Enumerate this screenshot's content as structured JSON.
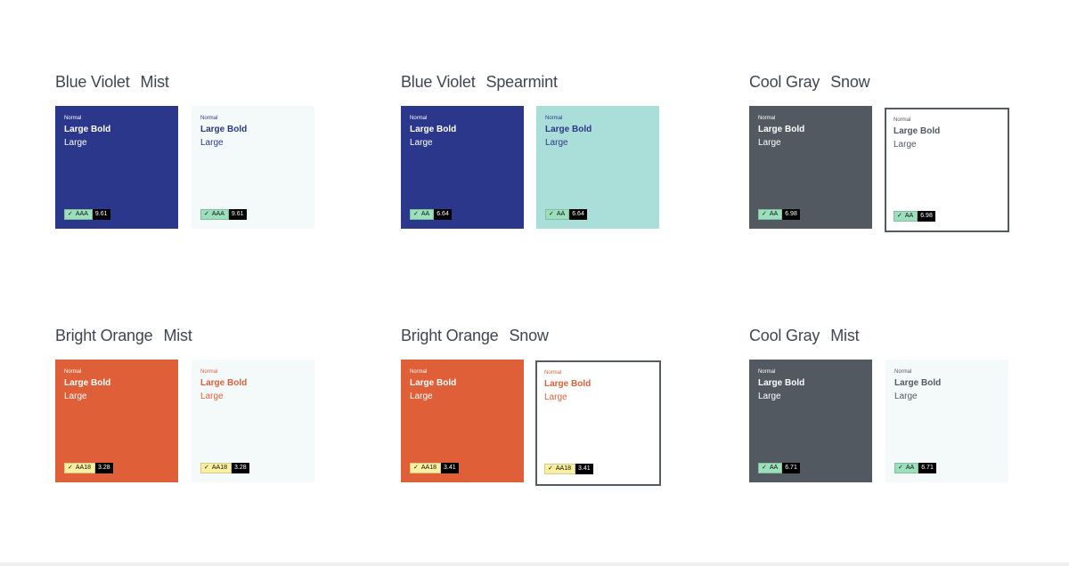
{
  "labels": {
    "normal": "Normal",
    "large_bold": "Large Bold",
    "large": "Large"
  },
  "colors": {
    "blue_violet": "#2b378a",
    "mist": "#f4fafa",
    "spearmint": "#aadfd9",
    "cool_gray": "#535961",
    "snow": "#ffffff",
    "bright_orange": "#de5f38",
    "badge_green": "#9bdfbb",
    "badge_yellow": "#f8efa0"
  },
  "pairs": [
    {
      "name1": "Blue Violet",
      "name2": "Mist",
      "a": {
        "bg": "#2b378a",
        "fg": "#ffffff",
        "level": "AAA",
        "ratio": "9.61",
        "badge": "#9bdfbb"
      },
      "b": {
        "bg": "#f4fafa",
        "fg": "#2b378a",
        "level": "AAA",
        "ratio": "9.61",
        "badge": "#9bdfbb"
      }
    },
    {
      "name1": "Blue Violet",
      "name2": "Spearmint",
      "a": {
        "bg": "#2b378a",
        "fg": "#ffffff",
        "level": "AA",
        "ratio": "6.64",
        "badge": "#9bdfbb"
      },
      "b": {
        "bg": "#aadfd9",
        "fg": "#2b378a",
        "level": "AA",
        "ratio": "6.64",
        "badge": "#9bdfbb"
      }
    },
    {
      "name1": "Cool Gray",
      "name2": "Snow",
      "a": {
        "bg": "#535961",
        "fg": "#ffffff",
        "level": "AA",
        "ratio": "6.98",
        "badge": "#9bdfbb"
      },
      "b": {
        "bg": "#ffffff",
        "fg": "#535961",
        "level": "AA",
        "ratio": "6.98",
        "badge": "#9bdfbb"
      }
    },
    {
      "name1": "Bright Orange",
      "name2": "Mist",
      "a": {
        "bg": "#de5f38",
        "fg": "#ffffff",
        "level": "AA18",
        "ratio": "3.28",
        "badge": "#f8efa0"
      },
      "b": {
        "bg": "#f4fafa",
        "fg": "#de5f38",
        "level": "AA18",
        "ratio": "3.28",
        "badge": "#f8efa0"
      }
    },
    {
      "name1": "Bright Orange",
      "name2": "Snow",
      "a": {
        "bg": "#de5f38",
        "fg": "#ffffff",
        "level": "AA18",
        "ratio": "3.41",
        "badge": "#f8efa0"
      },
      "b": {
        "bg": "#ffffff",
        "fg": "#de5f38",
        "level": "AA18",
        "ratio": "3.41",
        "badge": "#f8efa0"
      }
    },
    {
      "name1": "Cool Gray",
      "name2": "Mist",
      "a": {
        "bg": "#535961",
        "fg": "#ffffff",
        "level": "AA",
        "ratio": "6.71",
        "badge": "#9bdfbb"
      },
      "b": {
        "bg": "#f4fafa",
        "fg": "#535961",
        "level": "AA",
        "ratio": "6.71",
        "badge": "#9bdfbb"
      }
    }
  ]
}
